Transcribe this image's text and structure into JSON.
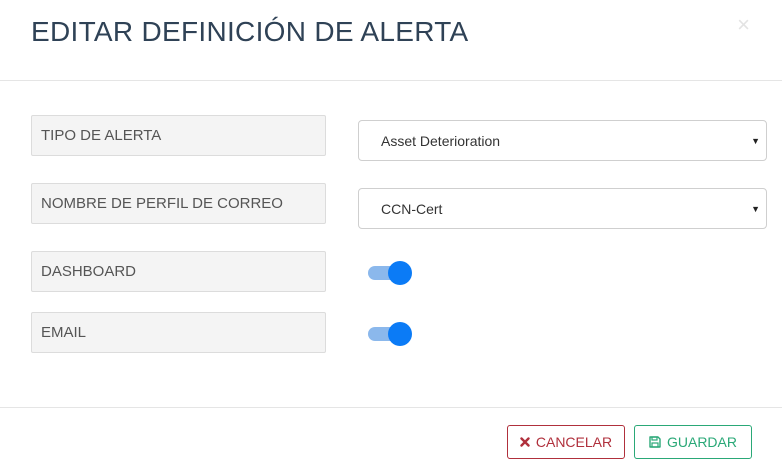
{
  "modal": {
    "title": "EDITAR DEFINICIÓN DE ALERTA",
    "close_icon": "close-icon"
  },
  "form": {
    "alert_type": {
      "label": "TIPO DE ALERTA",
      "selected": "Asset Deterioration"
    },
    "mail_profile": {
      "label": "NOMBRE DE PERFIL DE CORREO",
      "selected": "CCN-Cert"
    },
    "dashboard": {
      "label": "DASHBOARD",
      "enabled": true
    },
    "email": {
      "label": "EMAIL",
      "enabled": true
    }
  },
  "footer": {
    "cancel_label": "CANCELAR",
    "cancel_icon": "times-icon",
    "save_label": "GUARDAR",
    "save_icon": "floppy-disk-icon"
  },
  "colors": {
    "title": "#2f4256",
    "toggle_on": "#0b7bf6",
    "toggle_track": "#8bb8ec",
    "cancel": "#b0303c",
    "save": "#2aa877"
  }
}
